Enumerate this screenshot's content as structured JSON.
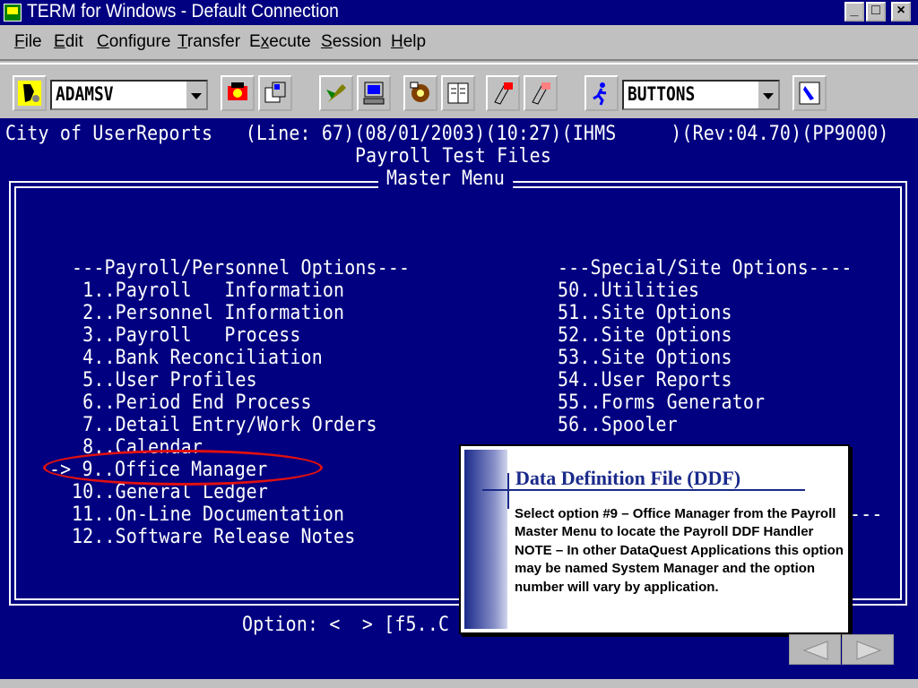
{
  "window": {
    "title": "TERM for Windows - Default Connection"
  },
  "menu": [
    {
      "pre": "",
      "key": "F",
      "post": "ile"
    },
    {
      "pre": "",
      "key": "E",
      "post": "dit"
    },
    {
      "pre": "",
      "key": "C",
      "post": "onfigure"
    },
    {
      "pre": "",
      "key": "T",
      "post": "ransfer"
    },
    {
      "pre": "E",
      "key": "x",
      "post": "ecute"
    },
    {
      "pre": "",
      "key": "S",
      "post": "ession"
    },
    {
      "pre": "",
      "key": "H",
      "post": "elp"
    }
  ],
  "toolbar": {
    "script_combo": "ADAMSV",
    "mode_combo": "BUTTONS"
  },
  "terminal": {
    "status_line": "City of UserReports   (Line: 67)(08/01/2003)(10:27)(IHMS     )(Rev:04.70)(PP9000)",
    "subtitle": "Payroll Test Files",
    "frame_title": "Master Menu",
    "left_header": "---Payroll/Personnel Options---",
    "right_header": "---Special/Site Options----",
    "left_items": [
      " 1..Payroll   Information",
      " 2..Personnel Information",
      " 3..Payroll   Process",
      " 4..Bank Reconciliation",
      " 5..User Profiles",
      " 6..Period End Process",
      " 7..Detail Entry/Work Orders",
      " 8..Calendar",
      "-> 9..Office Manager",
      "10..General Ledger",
      "11..On-Line Documentation",
      "12..Software Release Notes"
    ],
    "right_items": [
      "50..Utilities",
      "51..Site Options",
      "52..Site Options",
      "53..Site Options",
      "54..User Reports",
      "55..Forms Generator",
      "56..Spooler"
    ],
    "right_tail": "---",
    "option_prompt": "Option: <  > [f5..C"
  },
  "callout": {
    "title": "Data Definition File (DDF)",
    "body": "Select option #9 – Office Manager from the Payroll Master Menu to locate the Payroll DDF Handler\nNOTE – In other DataQuest Applications this option may be named System Manager and the option number will vary by application."
  },
  "colors": {
    "terminal_bg": "#000080",
    "highlight": "#e01010",
    "callout_title": "#1a2a8a"
  },
  "icons": [
    "app-icon",
    "phone-icon",
    "camera-icon",
    "wrench-icon",
    "computer-icon",
    "gear-icon",
    "book-icon",
    "tools-icon",
    "pen-icon",
    "runner-icon",
    "hand-icon",
    "prev-arrow-icon",
    "next-arrow-icon"
  ]
}
